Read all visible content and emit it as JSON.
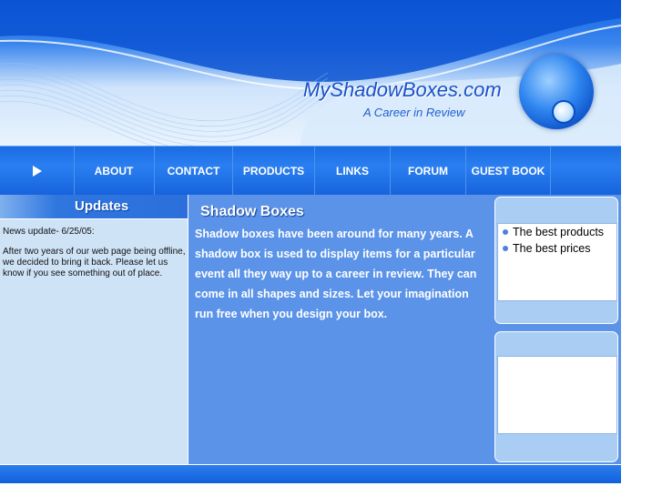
{
  "header": {
    "site_title": "MyShadowBoxes.com",
    "tagline": "A Career in Review"
  },
  "nav": {
    "items": [
      {
        "label": "ABOUT"
      },
      {
        "label": "CONTACT"
      },
      {
        "label": "PRODUCTS"
      },
      {
        "label": "LINKS"
      },
      {
        "label": "FORUM"
      },
      {
        "label": "GUEST BOOK"
      }
    ],
    "play_icon": "play-arrow-icon"
  },
  "updates": {
    "heading": "Updates",
    "date_line": "News update- 6/25/05:",
    "body": "After two years of our web page being offline, we decided to bring it back.  Please let us know if you see something out of place."
  },
  "main": {
    "title": "Shadow Boxes",
    "text": "Shadow boxes have been around for many years. A shadow box is used to display items for a particular event all they way up to a career in review. They can come in all shapes and sizes.  Let your imagination run free when you design your box."
  },
  "sidebar": {
    "bullets": [
      "The best products",
      "The best prices"
    ]
  },
  "colors": {
    "nav_blue": "#1b6be3",
    "content_blue": "#5b93e8",
    "panel_light": "#cfe3f7"
  }
}
